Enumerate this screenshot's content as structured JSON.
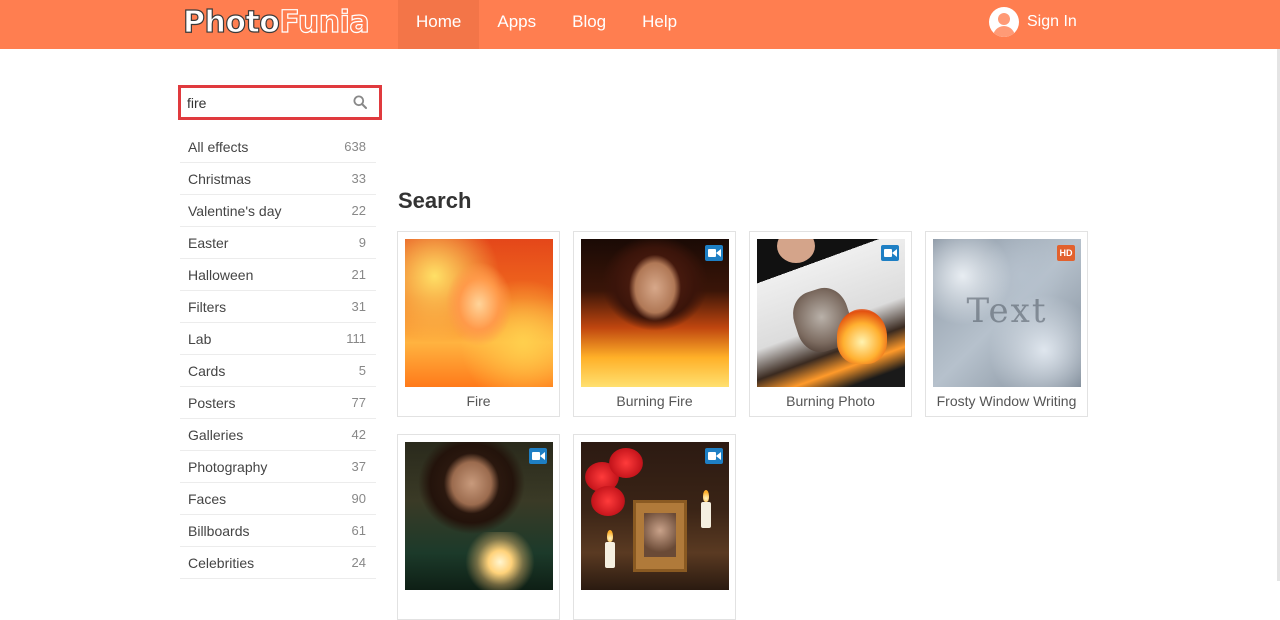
{
  "header": {
    "logo_part1": "Photo",
    "logo_part2": "Funia",
    "nav": [
      {
        "label": "Home",
        "active": true
      },
      {
        "label": "Apps"
      },
      {
        "label": "Blog"
      },
      {
        "label": "Help"
      }
    ],
    "signin_label": "Sign In",
    "colors": {
      "bar": "#ff7e50",
      "active_tab": "#f37548"
    }
  },
  "search": {
    "value": "fire",
    "icon": "search-icon",
    "highlight_color": "#e03a3e"
  },
  "sidebar": {
    "items": [
      {
        "label": "All effects",
        "count": "638"
      },
      {
        "label": "Christmas",
        "count": "33"
      },
      {
        "label": "Valentine's day",
        "count": "22"
      },
      {
        "label": "Easter",
        "count": "9"
      },
      {
        "label": "Halloween",
        "count": "21"
      },
      {
        "label": "Filters",
        "count": "31"
      },
      {
        "label": "Lab",
        "count": "111"
      },
      {
        "label": "Cards",
        "count": "5"
      },
      {
        "label": "Posters",
        "count": "77"
      },
      {
        "label": "Galleries",
        "count": "42"
      },
      {
        "label": "Photography",
        "count": "37"
      },
      {
        "label": "Faces",
        "count": "90"
      },
      {
        "label": "Billboards",
        "count": "61"
      },
      {
        "label": "Celebrities",
        "count": "24"
      }
    ]
  },
  "main": {
    "title": "Search",
    "results": [
      {
        "title": "Fire",
        "badge": ""
      },
      {
        "title": "Burning Fire",
        "badge": "video"
      },
      {
        "title": "Burning Photo",
        "badge": "video"
      },
      {
        "title": "Frosty Window Writing",
        "badge": "HD",
        "thumb_text": "Text"
      },
      {
        "title": "",
        "badge": "video"
      },
      {
        "title": "",
        "badge": "video"
      }
    ]
  }
}
